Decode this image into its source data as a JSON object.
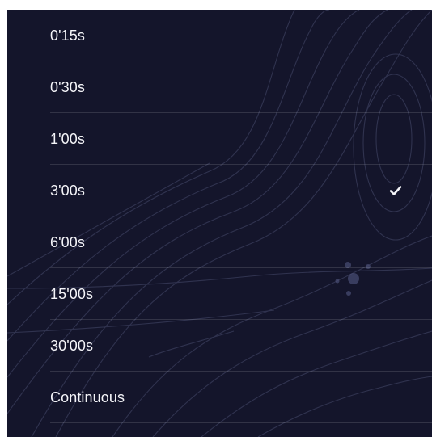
{
  "duration_list": {
    "items": [
      {
        "label": "0'15s",
        "selected": false
      },
      {
        "label": "0'30s",
        "selected": false
      },
      {
        "label": "1'00s",
        "selected": false
      },
      {
        "label": "3'00s",
        "selected": true
      },
      {
        "label": "6'00s",
        "selected": false
      },
      {
        "label": "15'00s",
        "selected": false
      },
      {
        "label": "30'00s",
        "selected": false
      },
      {
        "label": "Continuous",
        "selected": false
      }
    ],
    "selected_icon": "checkmark-icon"
  },
  "colors": {
    "background": "#14152b",
    "text": "#f4f4f8",
    "divider": "rgba(255,255,255,0.13)",
    "contour": "#3a3d5c"
  }
}
